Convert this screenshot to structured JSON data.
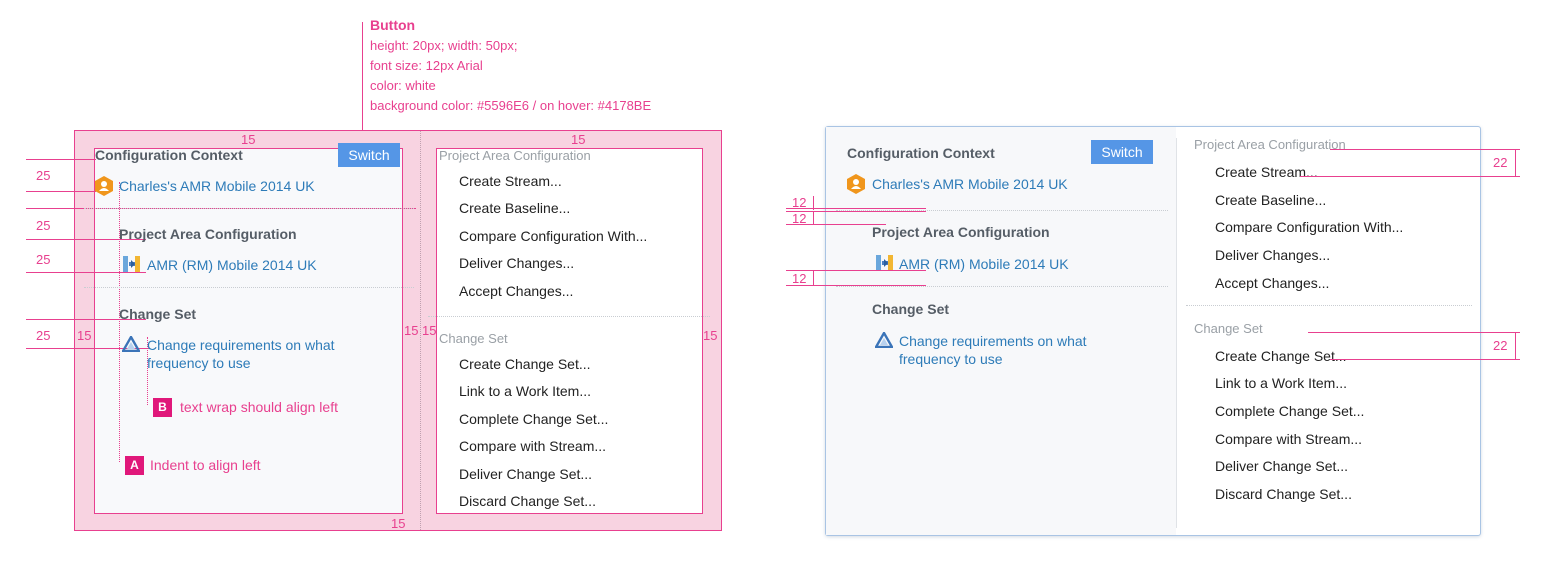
{
  "annotation": {
    "title": "Button",
    "lines": [
      "height: 20px; width: 50px;",
      "font size: 12px Arial",
      "color: white",
      "background color: #5596E6 / on hover: #4178BE"
    ],
    "spacing": {
      "s15": "15",
      "s25": "25",
      "s12": "12",
      "s22": "22"
    },
    "note_a_badge": "A",
    "note_a": "Indent to align left",
    "note_b_badge": "B",
    "note_b": "text wrap should align left"
  },
  "panel": {
    "config_context": "Configuration Context",
    "switch_label": "Switch",
    "context_link": "Charles's AMR Mobile 2014 UK",
    "project_area_heading": "Project Area Configuration",
    "project_link": "AMR (RM) Mobile 2014 UK",
    "change_set_heading": "Change Set",
    "change_set_link": "Change requirements on what frequency to use",
    "menu": {
      "project_section": "Project Area Configuration",
      "project_items": [
        "Create Stream...",
        "Create Baseline...",
        "Compare Configuration With...",
        "Deliver Changes...",
        "Accept Changes..."
      ],
      "change_section": "Change Set",
      "change_items": [
        "Create Change Set...",
        "Link to a Work Item...",
        "Complete Change Set...",
        "Compare with Stream...",
        "Deliver Change Set...",
        "Discard Change Set..."
      ]
    }
  },
  "colors": {
    "accent": "#e8408f",
    "button_bg": "#5596E6",
    "button_hover": "#4178BE",
    "link": "#2d7bb8"
  },
  "icons": [
    "hexagon-user-icon",
    "project-area-icon",
    "change-set-triangle-icon"
  ]
}
